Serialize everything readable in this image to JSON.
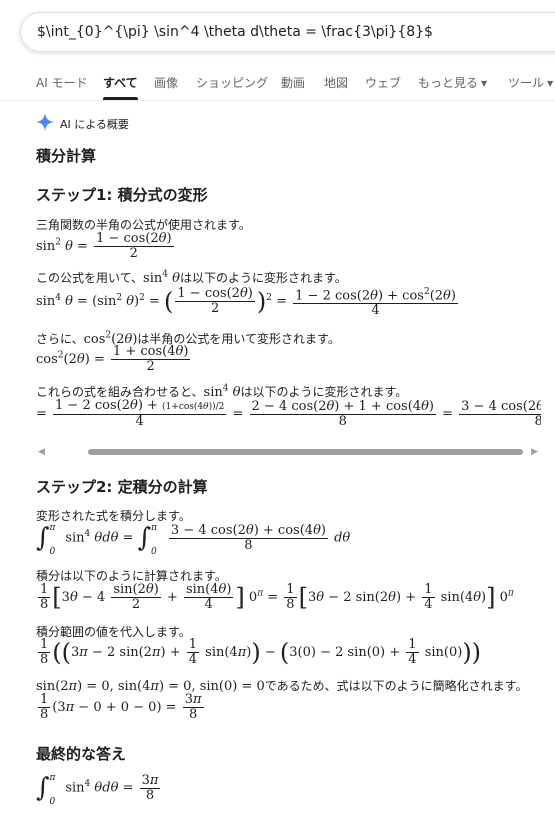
{
  "search": {
    "query": "$\\int_{0}^{\\pi} \\sin^4 \\theta d\\theta = \\frac{3\\pi}{8}$"
  },
  "tabs": [
    "AI モード",
    "すべて",
    "画像",
    "ショッピング",
    "動画",
    "地図",
    "ウェブ",
    "もっと見る",
    "ツール"
  ],
  "ai_label": "AI による概要",
  "title": "積分計算",
  "step1": {
    "heading": "ステップ1: 積分式の変形",
    "t1": "三角関数の半角の公式が使用されます。",
    "t2a": "この公式を用いて、",
    "t2b": "は以下のように変形されます。",
    "t3a": "さらに、",
    "t3b": "は半角の公式を用いて変形されます。",
    "t4a": "これらの式を組み合わせると、",
    "t4b": "は以下のように変形されます。"
  },
  "step2": {
    "heading": "ステップ2: 定積分の計算",
    "t1": "変形された式を積分します。",
    "t2": "積分は以下のように計算されます。",
    "t3": "積分範囲の値を代入します。",
    "t4": "であるため、式は以下のように簡略化されます。"
  },
  "final": {
    "heading": "最終的な答え"
  }
}
